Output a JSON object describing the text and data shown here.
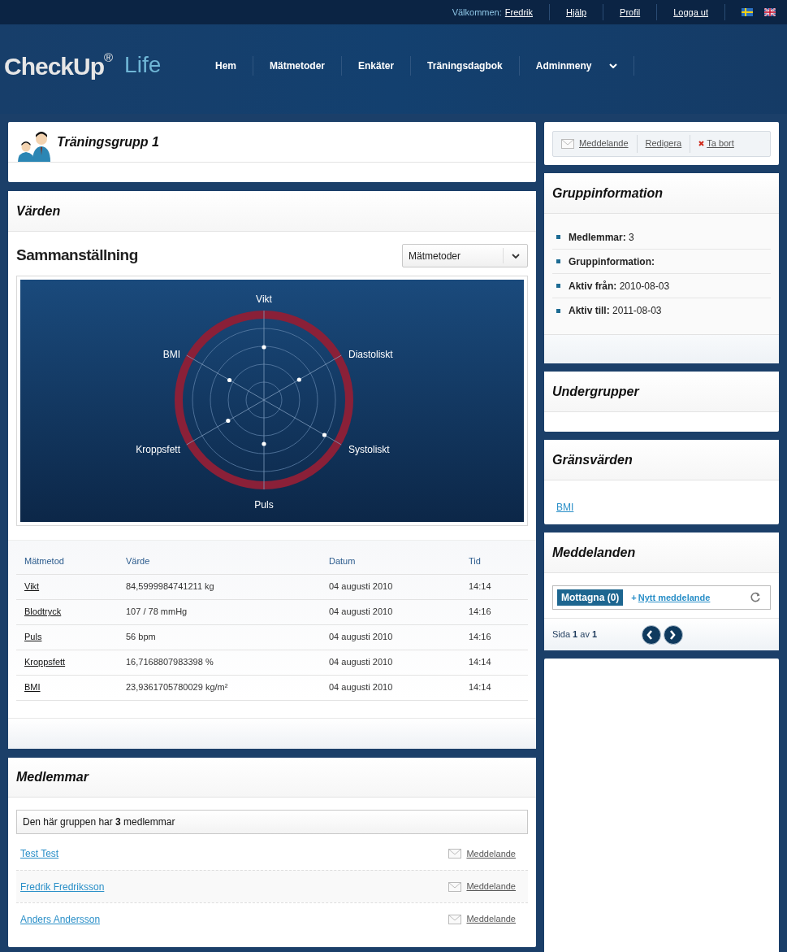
{
  "top_bar": {
    "welcome": "Välkommen:",
    "user": "Fredrik",
    "links": [
      "Hjälp",
      "Profil",
      "Logga ut"
    ]
  },
  "logo": {
    "name": "CheckUp",
    "mark": "®",
    "suffix": "Life"
  },
  "nav": [
    {
      "label": "Hem",
      "dropdown": false
    },
    {
      "label": "Mätmetoder",
      "dropdown": false
    },
    {
      "label": "Enkäter",
      "dropdown": false
    },
    {
      "label": "Träningsdagbok",
      "dropdown": false
    },
    {
      "label": "Adminmeny",
      "dropdown": true
    }
  ],
  "group": {
    "title": "Träningsgrupp 1"
  },
  "values_panel": {
    "title": "Värden",
    "summary_title": "Sammanställning",
    "select": "Mätmetoder",
    "radar_axes": [
      "Vikt",
      "Diastoliskt",
      "Systoliskt",
      "Puls",
      "Kroppsfett",
      "BMI"
    ],
    "table": {
      "columns": [
        "Mätmetod",
        "Värde",
        "Datum",
        "Tid"
      ],
      "rows": [
        [
          "Vikt",
          "84,5999984741211 kg",
          "04 augusti 2010",
          "14:14"
        ],
        [
          "Blodtryck",
          "107 / 78 mmHg",
          "04 augusti 2010",
          "14:16"
        ],
        [
          "Puls",
          "56 bpm",
          "04 augusti 2010",
          "14:16"
        ],
        [
          "Kroppsfett",
          "16,7168807983398 %",
          "04 augusti 2010",
          "14:14"
        ],
        [
          "BMI",
          "23,9361705780029 kg/m²",
          "04 augusti 2010",
          "14:14"
        ]
      ]
    }
  },
  "members": {
    "title": "Medlemmar",
    "summary": "Den här gruppen har **3** medlemmar",
    "rows": [
      {
        "name": "Test Test",
        "action": "Meddelande"
      },
      {
        "name": "Fredrik Fredriksson",
        "action": "Meddelande"
      },
      {
        "name": "Anders Andersson",
        "action": "Meddelande"
      }
    ]
  },
  "actions": [
    {
      "label": "Meddelande",
      "kind": "mail"
    },
    {
      "label": "Redigera",
      "kind": "plain"
    },
    {
      "label": "Ta bort",
      "kind": "delete"
    }
  ],
  "group_info": {
    "title": "Gruppinformation",
    "items": [
      {
        "label": "Medlemmar:",
        "value": "3"
      },
      {
        "label": "Gruppinformation:"
      },
      {
        "label": "Aktiv från:",
        "value": "2010-08-03"
      },
      {
        "label": "Aktiv till:",
        "value": "2011-08-03"
      }
    ]
  },
  "subgroups": {
    "title": "Undergrupper"
  },
  "limits": {
    "title": "Gränsvärden",
    "links": [
      "BMI"
    ]
  },
  "messages": {
    "title": "Meddelanden",
    "tab": "Mottagna (0)",
    "new_mark": "+",
    "new_label": "Nytt meddelande",
    "pager": "Sida **1** av **1**"
  }
}
